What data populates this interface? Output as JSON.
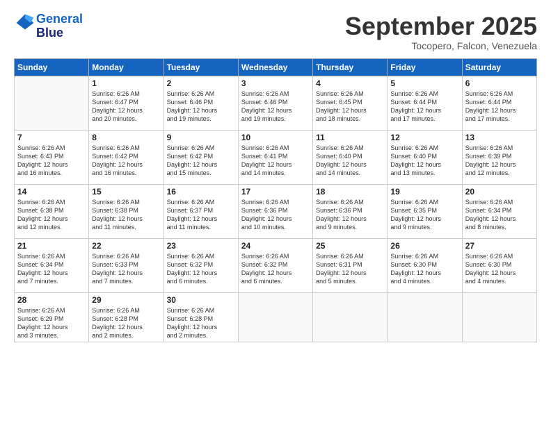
{
  "logo": {
    "line1": "General",
    "line2": "Blue"
  },
  "title": "September 2025",
  "subtitle": "Tocopero, Falcon, Venezuela",
  "weekdays": [
    "Sunday",
    "Monday",
    "Tuesday",
    "Wednesday",
    "Thursday",
    "Friday",
    "Saturday"
  ],
  "weeks": [
    [
      {
        "day": "",
        "info": ""
      },
      {
        "day": "1",
        "info": "Sunrise: 6:26 AM\nSunset: 6:47 PM\nDaylight: 12 hours\nand 20 minutes."
      },
      {
        "day": "2",
        "info": "Sunrise: 6:26 AM\nSunset: 6:46 PM\nDaylight: 12 hours\nand 19 minutes."
      },
      {
        "day": "3",
        "info": "Sunrise: 6:26 AM\nSunset: 6:46 PM\nDaylight: 12 hours\nand 19 minutes."
      },
      {
        "day": "4",
        "info": "Sunrise: 6:26 AM\nSunset: 6:45 PM\nDaylight: 12 hours\nand 18 minutes."
      },
      {
        "day": "5",
        "info": "Sunrise: 6:26 AM\nSunset: 6:44 PM\nDaylight: 12 hours\nand 17 minutes."
      },
      {
        "day": "6",
        "info": "Sunrise: 6:26 AM\nSunset: 6:44 PM\nDaylight: 12 hours\nand 17 minutes."
      }
    ],
    [
      {
        "day": "7",
        "info": "Sunrise: 6:26 AM\nSunset: 6:43 PM\nDaylight: 12 hours\nand 16 minutes."
      },
      {
        "day": "8",
        "info": "Sunrise: 6:26 AM\nSunset: 6:42 PM\nDaylight: 12 hours\nand 16 minutes."
      },
      {
        "day": "9",
        "info": "Sunrise: 6:26 AM\nSunset: 6:42 PM\nDaylight: 12 hours\nand 15 minutes."
      },
      {
        "day": "10",
        "info": "Sunrise: 6:26 AM\nSunset: 6:41 PM\nDaylight: 12 hours\nand 14 minutes."
      },
      {
        "day": "11",
        "info": "Sunrise: 6:26 AM\nSunset: 6:40 PM\nDaylight: 12 hours\nand 14 minutes."
      },
      {
        "day": "12",
        "info": "Sunrise: 6:26 AM\nSunset: 6:40 PM\nDaylight: 12 hours\nand 13 minutes."
      },
      {
        "day": "13",
        "info": "Sunrise: 6:26 AM\nSunset: 6:39 PM\nDaylight: 12 hours\nand 12 minutes."
      }
    ],
    [
      {
        "day": "14",
        "info": "Sunrise: 6:26 AM\nSunset: 6:38 PM\nDaylight: 12 hours\nand 12 minutes."
      },
      {
        "day": "15",
        "info": "Sunrise: 6:26 AM\nSunset: 6:38 PM\nDaylight: 12 hours\nand 11 minutes."
      },
      {
        "day": "16",
        "info": "Sunrise: 6:26 AM\nSunset: 6:37 PM\nDaylight: 12 hours\nand 11 minutes."
      },
      {
        "day": "17",
        "info": "Sunrise: 6:26 AM\nSunset: 6:36 PM\nDaylight: 12 hours\nand 10 minutes."
      },
      {
        "day": "18",
        "info": "Sunrise: 6:26 AM\nSunset: 6:36 PM\nDaylight: 12 hours\nand 9 minutes."
      },
      {
        "day": "19",
        "info": "Sunrise: 6:26 AM\nSunset: 6:35 PM\nDaylight: 12 hours\nand 9 minutes."
      },
      {
        "day": "20",
        "info": "Sunrise: 6:26 AM\nSunset: 6:34 PM\nDaylight: 12 hours\nand 8 minutes."
      }
    ],
    [
      {
        "day": "21",
        "info": "Sunrise: 6:26 AM\nSunset: 6:34 PM\nDaylight: 12 hours\nand 7 minutes."
      },
      {
        "day": "22",
        "info": "Sunrise: 6:26 AM\nSunset: 6:33 PM\nDaylight: 12 hours\nand 7 minutes."
      },
      {
        "day": "23",
        "info": "Sunrise: 6:26 AM\nSunset: 6:32 PM\nDaylight: 12 hours\nand 6 minutes."
      },
      {
        "day": "24",
        "info": "Sunrise: 6:26 AM\nSunset: 6:32 PM\nDaylight: 12 hours\nand 6 minutes."
      },
      {
        "day": "25",
        "info": "Sunrise: 6:26 AM\nSunset: 6:31 PM\nDaylight: 12 hours\nand 5 minutes."
      },
      {
        "day": "26",
        "info": "Sunrise: 6:26 AM\nSunset: 6:30 PM\nDaylight: 12 hours\nand 4 minutes."
      },
      {
        "day": "27",
        "info": "Sunrise: 6:26 AM\nSunset: 6:30 PM\nDaylight: 12 hours\nand 4 minutes."
      }
    ],
    [
      {
        "day": "28",
        "info": "Sunrise: 6:26 AM\nSunset: 6:29 PM\nDaylight: 12 hours\nand 3 minutes."
      },
      {
        "day": "29",
        "info": "Sunrise: 6:26 AM\nSunset: 6:28 PM\nDaylight: 12 hours\nand 2 minutes."
      },
      {
        "day": "30",
        "info": "Sunrise: 6:26 AM\nSunset: 6:28 PM\nDaylight: 12 hours\nand 2 minutes."
      },
      {
        "day": "",
        "info": ""
      },
      {
        "day": "",
        "info": ""
      },
      {
        "day": "",
        "info": ""
      },
      {
        "day": "",
        "info": ""
      }
    ]
  ]
}
